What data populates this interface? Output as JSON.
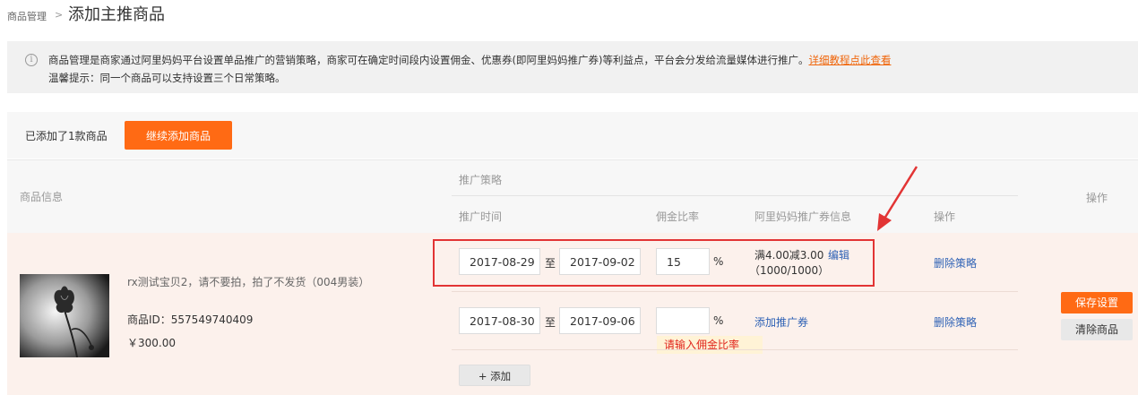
{
  "breadcrumb": {
    "root": "商品管理",
    "separator": ">",
    "title": "添加主推商品"
  },
  "notice": {
    "line1": "商品管理是商家通过阿里妈妈平台设置单品推广的营销策略，商家可在确定时间段内设置佣金、优惠券(即阿里妈妈推广券)等利益点，平台会分发给流量媒体进行推广。",
    "link": "详细教程点此查看",
    "line2": "温馨提示：同一个商品可以支持设置三个日常策略。"
  },
  "toolbar": {
    "added_count": "已添加了1款商品",
    "add_button": "继续添加商品"
  },
  "table": {
    "col_product_info": "商品信息",
    "col_strategy": "推广策略",
    "col_time": "推广时间",
    "col_rate": "佣金比率",
    "col_coupon": "阿里妈妈推广券信息",
    "col_strategy_op": "操作",
    "col_op": "操作"
  },
  "product": {
    "name": "rx测试宝贝2，请不要拍，拍了不发货（004男装）",
    "id_label": "商品ID：557549740409",
    "price": "￥300.00"
  },
  "strategies": [
    {
      "start": "2017-08-29",
      "to": "至",
      "end": "2017-09-02",
      "rate": "15",
      "pct": "%",
      "coupon": "满4.00减3.00",
      "coupon_edit": "编辑",
      "coupon_qty": "（1000/1000）",
      "delete": "删除策略"
    },
    {
      "start": "2017-08-30",
      "to": "至",
      "end": "2017-09-06",
      "rate": "",
      "pct": "%",
      "coupon_add": "添加推广券",
      "delete": "删除策略",
      "error": "请输入佣金比率"
    }
  ],
  "add_strategy": "+ 添加",
  "actions": {
    "save": "保存设置",
    "clear": "清除商品"
  },
  "colors": {
    "accent": "#ff6a14",
    "link": "#2f62b5",
    "annotation": "#e23434",
    "row_bg": "#fcf1ec"
  },
  "icons": {
    "notice": "info-circle-icon",
    "annotation": "arrow-icon"
  }
}
